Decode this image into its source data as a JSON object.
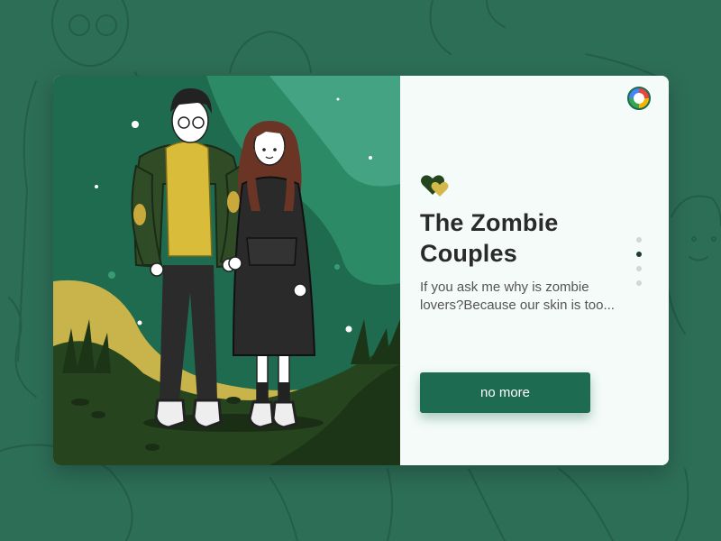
{
  "card": {
    "title": "The Zombie\nCouples",
    "description": "If you ask me why is zombie lovers?Because our skin is too...",
    "button_label": "no more",
    "pagination": {
      "total": 4,
      "active_index": 1
    }
  },
  "colors": {
    "background": "#2d6e57",
    "illustration_bg": "#1e6b50",
    "accent_green": "#1d6b50",
    "accent_yellow": "#d4b94a",
    "heart_dark": "#24461f"
  },
  "icons": {
    "badge": "app-logo-icon",
    "hearts": "hearts-icon"
  }
}
